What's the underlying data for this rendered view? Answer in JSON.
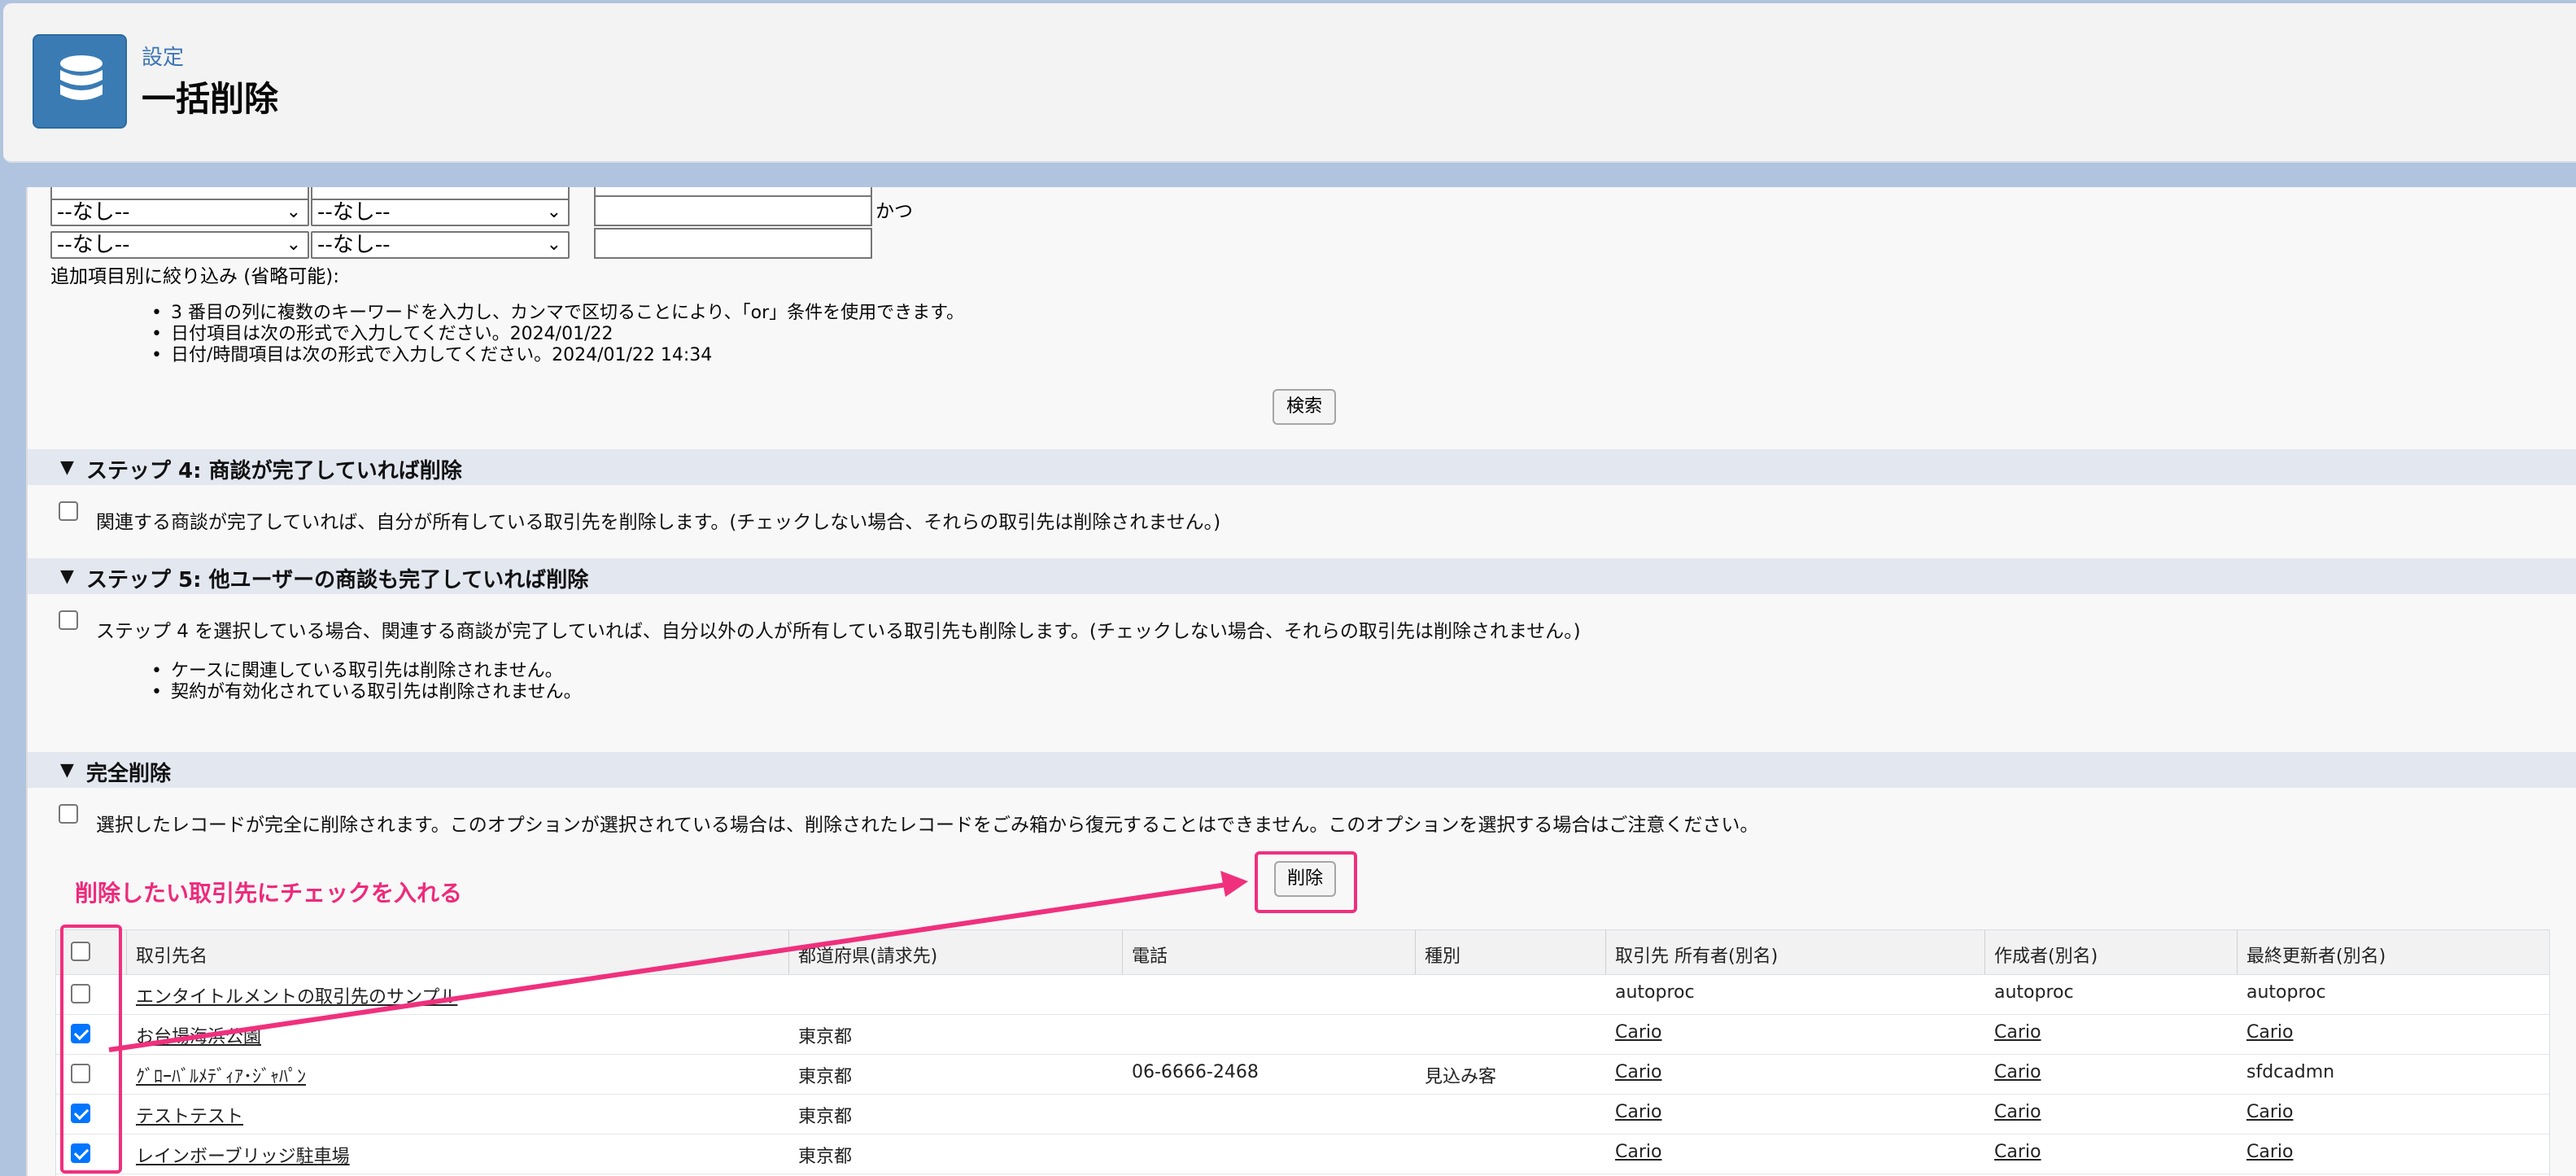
{
  "header": {
    "subtitle": "設定",
    "title": "一括削除",
    "icon": "database-icon"
  },
  "filters": {
    "rows": [
      {
        "field": "--なし--",
        "operator": "--なし--",
        "value": "",
        "conjunction": "かつ"
      },
      {
        "field": "--なし--",
        "operator": "--なし--",
        "value": "",
        "conjunction": ""
      }
    ],
    "additional_label": "追加項目別に絞り込み (省略可能):",
    "hints": [
      "3 番目の列に複数のキーワードを入力し、カンマで区切ることにより、「or」条件を使用できます。",
      "日付項目は次の形式で入力してください。2024/01/22",
      "日付/時間項目は次の形式で入力してください。2024/01/22 14:34"
    ],
    "search_button": "検索"
  },
  "step4": {
    "title": "ステップ 4: 商談が完了していれば削除",
    "checkbox_label": "関連する商談が完了していれば、自分が所有している取引先を削除します。(チェックしない場合、それらの取引先は削除されません。)"
  },
  "step5": {
    "title": "ステップ 5: 他ユーザーの商談も完了していれば削除",
    "checkbox_label": "ステップ 4 を選択している場合、関連する商談が完了していれば、自分以外の人が所有している取引先も削除します。(チェックしない場合、それらの取引先は削除されません。)",
    "notes": [
      "ケースに関連している取引先は削除されません。",
      "契約が有効化されている取引先は削除されません。"
    ]
  },
  "hard_delete": {
    "title": "完全削除",
    "checkbox_label": "選択したレコードが完全に削除されます。このオプションが選択されている場合は、削除されたレコードをごみ箱から復元することはできません。このオプションを選択する場合はご注意ください。",
    "delete_button": "削除"
  },
  "annotation": {
    "text": "削除したい取引先にチェックを入れる",
    "color": "#ee2a7b"
  },
  "table": {
    "columns": [
      "取引先名",
      "都道府県(請求先)",
      "電話",
      "種別",
      "取引先 所有者(別名)",
      "作成者(別名)",
      "最終更新者(別名)"
    ],
    "rows": [
      {
        "checked": false,
        "name": "エンタイトルメントの取引先のサンプル",
        "state": "",
        "phone": "",
        "type": "",
        "owner": "autoproc",
        "created": "autoproc",
        "modified": "autoproc"
      },
      {
        "checked": true,
        "name": "お台場海浜公園",
        "state": "東京都",
        "phone": "",
        "type": "",
        "owner": "Cario",
        "created": "Cario",
        "modified": "Cario"
      },
      {
        "checked": false,
        "name": "ｸﾞﾛｰﾊﾞﾙﾒﾃﾞｨｱ･ｼﾞｬﾊﾟﾝ",
        "state": "東京都",
        "phone": "06-6666-2468",
        "type": "見込み客",
        "owner": "Cario",
        "created": "Cario",
        "modified": "sfdcadmn"
      },
      {
        "checked": true,
        "name": "テストテスト",
        "state": "東京都",
        "phone": "",
        "type": "",
        "owner": "Cario",
        "created": "Cario",
        "modified": "Cario"
      },
      {
        "checked": true,
        "name": "レインボーブリッジ駐車場",
        "state": "東京都",
        "phone": "",
        "type": "",
        "owner": "Cario",
        "created": "Cario",
        "modified": "Cario"
      }
    ]
  }
}
